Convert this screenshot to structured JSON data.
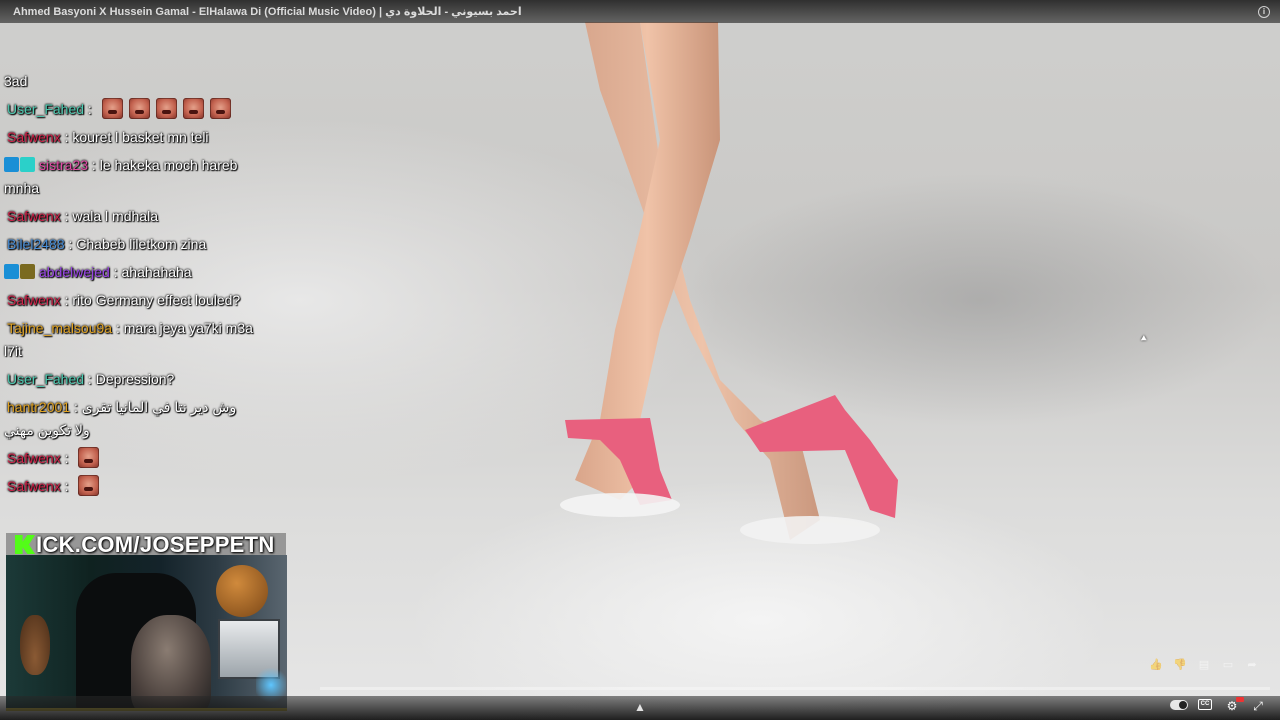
{
  "video": {
    "title": "Ahmed Basyoni X Hussein Gamal - ElHalawa Di (Official Music Video) | احمد بسيوني - الحلاوة دي",
    "progress": 0.0
  },
  "chat": {
    "messages": [
      {
        "user": "",
        "text": "3ad",
        "color": "#ffffff",
        "badges": [],
        "emotes": 0
      },
      {
        "user": "User_Fahed",
        "text": "",
        "color": "#4ec9b0",
        "badges": [],
        "emotes": 5
      },
      {
        "user": "Safwenx",
        "text": "kouret l basket mn teli",
        "color": "#d1234a",
        "badges": [],
        "emotes": 0
      },
      {
        "user": "sistra23",
        "text": "le hakeka moch hareb mnha",
        "color": "#e24aa6",
        "badges": [
          "b1",
          "b2"
        ],
        "emotes": 0
      },
      {
        "user": "Safwenx",
        "text": "wala l mdhala",
        "color": "#d1234a",
        "badges": [],
        "emotes": 0
      },
      {
        "user": "Bilel2488",
        "text": "Chabeb liletkom zina",
        "color": "#4a8fd8",
        "badges": [],
        "emotes": 0
      },
      {
        "user": "abdelwejed",
        "text": "ahahahaha",
        "color": "#9b47e8",
        "badges": [
          "b1",
          "b3"
        ],
        "emotes": 0
      },
      {
        "user": "Safwenx",
        "text": "rito Germany effect louled?",
        "color": "#d1234a",
        "badges": [],
        "emotes": 0
      },
      {
        "user": "Tajine_malsou9a",
        "text": "mara jeya ya7ki m3a l7it",
        "color": "#e0a323",
        "badges": [],
        "emotes": 0
      },
      {
        "user": "User_Fahed",
        "text": "Depression?",
        "color": "#4ec9b0",
        "badges": [],
        "emotes": 0
      },
      {
        "user": "hantr2001",
        "text": "وش دير نتا في المانيا تقرى ولا تكوين مهني",
        "color": "#e0a323",
        "badges": [],
        "emotes": 0
      },
      {
        "user": "Safwenx",
        "text": "",
        "color": "#d1234a",
        "badges": [],
        "emotes": 1
      },
      {
        "user": "Safwenx",
        "text": "",
        "color": "#d1234a",
        "badges": [],
        "emotes": 1
      }
    ]
  },
  "webcam": {
    "banner": "ICK.COM/JOSEPPETN",
    "logo_color": "#53fc18"
  },
  "controls": {
    "chevron": "▲",
    "actions": [
      "like-icon",
      "dislike-icon",
      "comment-icon",
      "chat-icon",
      "share-icon"
    ]
  }
}
